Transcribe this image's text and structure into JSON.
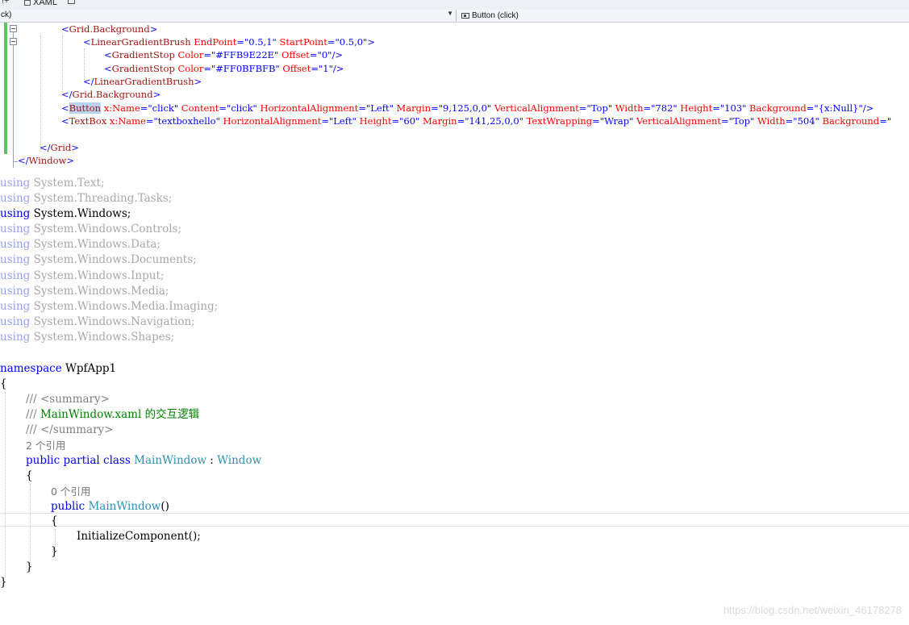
{
  "tabs": {
    "tab_glyph": "!+",
    "xaml_tab_label": "XAML"
  },
  "nav": {
    "left_text": "ck)",
    "right_text": "Button (click)"
  },
  "xaml": {
    "l1": {
      "a": "<",
      "b": "Grid.Background",
      "c": ">"
    },
    "l2": {
      "a": "<",
      "b": "LinearGradientBrush",
      "c": " EndPoint",
      "d": "=\"0.5,1\"",
      "e": " StartPoint",
      "f": "=\"0.5,0\"",
      "g": ">"
    },
    "l3": {
      "a": "<",
      "b": "GradientStop",
      "c": " Color",
      "d": "=\"#FFB9E22E\"",
      "e": " Offset",
      "f": "=\"0\"",
      "g": "/>"
    },
    "l4": {
      "a": "<",
      "b": "GradientStop",
      "c": " Color",
      "d": "=\"#FF0BFBFB\"",
      "e": " Offset",
      "f": "=\"1\"",
      "g": "/>"
    },
    "l5": {
      "a": "</",
      "b": "LinearGradientBrush",
      "c": ">"
    },
    "l6": {
      "a": "</",
      "b": "Grid.Background",
      "c": ">"
    },
    "l7": {
      "a": "<",
      "b": "Button",
      "c": " x:Name",
      "d": "=\"click\"",
      "e": " Content",
      "f": "=\"click\"",
      "g": " HorizontalAlignment",
      "h": "=\"Left\"",
      "i": " Margin",
      "j": "=\"9,125,0,0\"",
      "k": " VerticalAlignment",
      "l": "=\"Top\"",
      "m": " Width",
      "n": "=\"782\"",
      "o": " Height",
      "p": "=\"103\"",
      "q": " Background",
      "r": "=\"{x:Null}\"",
      "s": "/>"
    },
    "l8": {
      "a": "<",
      "b": "TextBox",
      "c": " x:Name",
      "d": "=\"textboxhello\"",
      "e": " HorizontalAlignment",
      "f": "=\"Left\"",
      "g": " Height",
      "h": "=\"60\"",
      "i": " Margin",
      "j": "=\"141,25,0,0\"",
      "k": " TextWrapping",
      "l": "=\"Wrap\"",
      "m": " VerticalAlignment",
      "n": "=\"Top\"",
      "o": " Width",
      "p": "=\"504\"",
      "q": " Background",
      "r": "=\""
    },
    "l9": {
      "a": "</",
      "b": "Grid",
      "c": ">"
    },
    "l10": {
      "a": "</",
      "b": "Window",
      "c": ">"
    }
  },
  "csharp": {
    "using_kw": "using",
    "usings": [
      "System.Text;",
      "System.Threading.Tasks;",
      "System.Windows;",
      "System.Windows.Controls;",
      "System.Windows.Data;",
      "System.Windows.Documents;",
      "System.Windows.Input;",
      "System.Windows.Media;",
      "System.Windows.Media.Imaging;",
      "System.Windows.Navigation;",
      "System.Windows.Shapes;"
    ],
    "namespace_kw": "namespace",
    "namespace_name": "WpfApp1",
    "open_brace": "{",
    "close_brace": "}",
    "doc_slashes": "///",
    "summary_open": "<summary>",
    "summary_text": "MainWindow.xaml 的交互逻辑",
    "summary_close": "</summary>",
    "class_refs": "2 个引用",
    "kw_public": "public",
    "kw_partial": "partial",
    "kw_class": "class",
    "class_name": "MainWindow",
    "colon": ":",
    "base_class": "Window",
    "ctor_refs": "0 个引用",
    "ctor_name": "MainWindow",
    "parens": "()",
    "call": "InitializeComponent",
    "call_suffix": "();"
  },
  "watermark": "https://blog.csdn.net/weixin_46178278"
}
